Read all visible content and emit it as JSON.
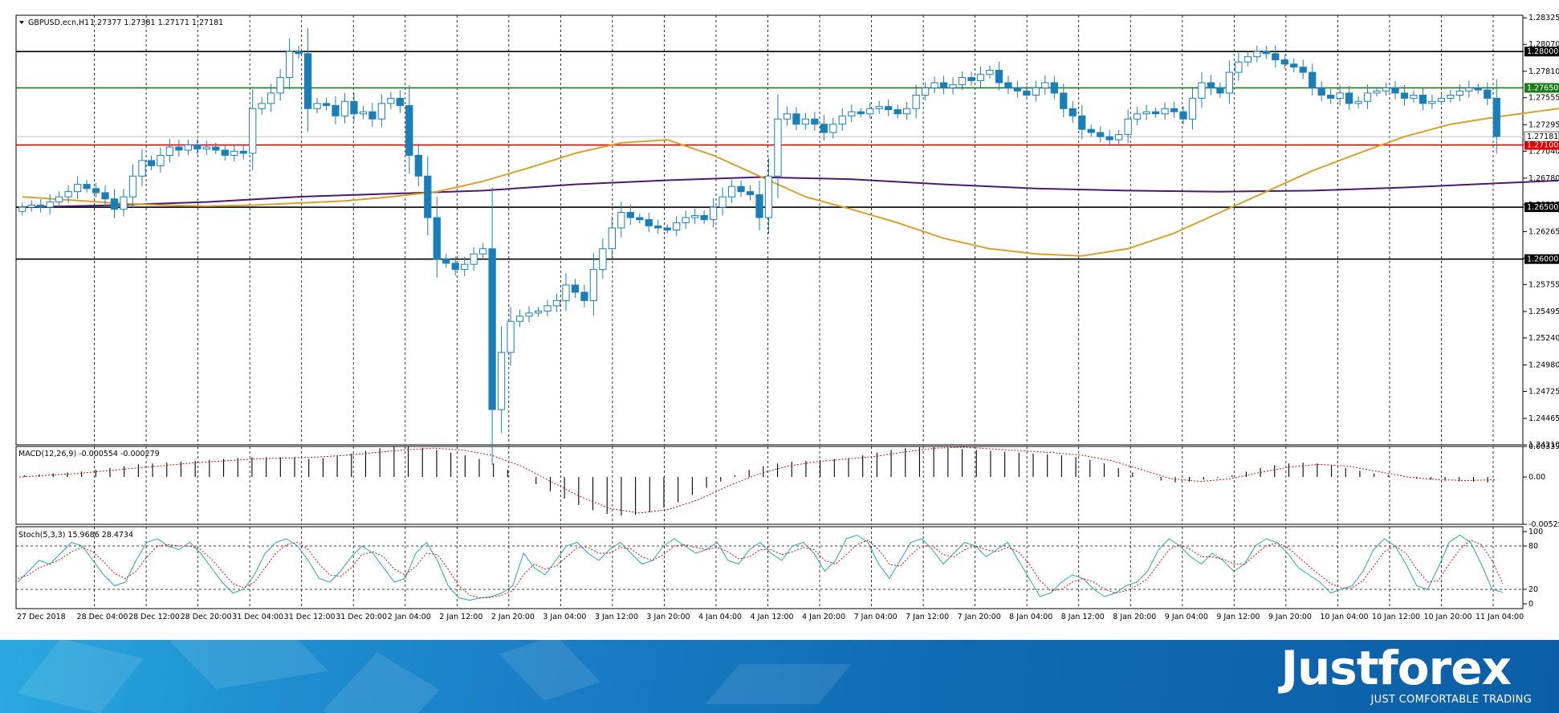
{
  "chart_data": {
    "type": "candlestick",
    "symbol_label": "GBPUSD.ecn,H1",
    "ohlc_label": "1.27377 1.27381 1.27171 1.27181",
    "price_axis": {
      "ylim": [
        1.2421,
        1.2835
      ],
      "ticks": [
        "1.28325",
        "1.28070",
        "1.27810",
        "1.27555",
        "1.27295",
        "1.27040",
        "1.26780",
        "1.26525",
        "1.26265",
        "1.26010",
        "1.25755",
        "1.25495",
        "1.25240",
        "1.24980",
        "1.24725",
        "1.24465",
        "1.24210"
      ]
    },
    "x_axis_labels": [
      "27 Dec 2018",
      "28 Dec 04:00",
      "28 Dec 12:00",
      "28 Dec 20:00",
      "31 Dec 04:00",
      "31 Dec 12:00",
      "31 Dec 20:00",
      "2 Jan 04:00",
      "2 Jan 12:00",
      "2 Jan 20:00",
      "3 Jan 04:00",
      "3 Jan 12:00",
      "3 Jan 20:00",
      "4 Jan 04:00",
      "4 Jan 12:00",
      "4 Jan 20:00",
      "7 Jan 04:00",
      "7 Jan 12:00",
      "7 Jan 20:00",
      "8 Jan 04:00",
      "8 Jan 12:00",
      "8 Jan 20:00",
      "9 Jan 04:00",
      "9 Jan 12:00",
      "9 Jan 20:00",
      "10 Jan 04:00",
      "10 Jan 12:00",
      "10 Jan 20:00",
      "11 Jan 04:00"
    ],
    "horizontal_levels": [
      {
        "price": 1.28,
        "label": "1.28000",
        "color": "#000000"
      },
      {
        "price": 1.2765,
        "label": "1.27650",
        "color": "#1a7a1a"
      },
      {
        "price": 1.271,
        "label": "1.27100",
        "color": "#e00000"
      },
      {
        "price": 1.265,
        "label": "1.26500",
        "color": "#000000"
      },
      {
        "price": 1.26,
        "label": "1.26000",
        "color": "#000000"
      }
    ],
    "current_price": {
      "price": 1.27181,
      "label": "1.27181"
    },
    "colors": {
      "candle": "#1a7fb8",
      "ma_fast": "#d6a12c",
      "ma_slow": "#4b1a6b",
      "macd_signal": "#d01010",
      "stoch_main": "#2aa6a6",
      "stoch_signal": "#d01010"
    },
    "close": [
      1.265,
      1.2652,
      1.265,
      1.2655,
      1.266,
      1.2665,
      1.2672,
      1.2668,
      1.2664,
      1.2658,
      1.2648,
      1.266,
      1.268,
      1.2695,
      1.269,
      1.27,
      1.2708,
      1.2705,
      1.271,
      1.2706,
      1.2708,
      1.2705,
      1.27,
      1.2704,
      1.2702,
      1.2745,
      1.275,
      1.276,
      1.2775,
      1.28,
      1.2798,
      1.2745,
      1.275,
      1.2748,
      1.2738,
      1.2752,
      1.274,
      1.2742,
      1.2735,
      1.275,
      1.2755,
      1.2748,
      1.27,
      1.268,
      1.264,
      1.26,
      1.2596,
      1.259,
      1.2595,
      1.2605,
      1.261,
      1.2455,
      1.251,
      1.254,
      1.2545,
      1.2548,
      1.255,
      1.2555,
      1.256,
      1.2575,
      1.2568,
      1.256,
      1.259,
      1.261,
      1.263,
      1.2645,
      1.264,
      1.2638,
      1.2632,
      1.263,
      1.2628,
      1.2635,
      1.264,
      1.2642,
      1.2638,
      1.265,
      1.266,
      1.267,
      1.2665,
      1.2662,
      1.264,
      1.268,
      1.2735,
      1.274,
      1.273,
      1.2735,
      1.273,
      1.2722,
      1.273,
      1.2738,
      1.2742,
      1.274,
      1.2745,
      1.2747,
      1.2744,
      1.274,
      1.2745,
      1.2758,
      1.2765,
      1.277,
      1.2765,
      1.2768,
      1.2775,
      1.2772,
      1.2778,
      1.2782,
      1.277,
      1.2765,
      1.2762,
      1.2758,
      1.2765,
      1.277,
      1.276,
      1.2745,
      1.2738,
      1.2725,
      1.2722,
      1.2718,
      1.2715,
      1.272,
      1.2735,
      1.274,
      1.2742,
      1.274,
      1.2745,
      1.2742,
      1.2735,
      1.2755,
      1.277,
      1.2765,
      1.276,
      1.278,
      1.279,
      1.2795,
      1.28,
      1.2798,
      1.2792,
      1.2788,
      1.2785,
      1.278,
      1.2765,
      1.2758,
      1.2755,
      1.276,
      1.275,
      1.2752,
      1.276,
      1.2762,
      1.2765,
      1.276,
      1.2755,
      1.2758,
      1.275,
      1.2752,
      1.2755,
      1.2758,
      1.2762,
      1.2765,
      1.2763,
      1.2755,
      1.27181
    ],
    "ma_fast": [
      1.266,
      1.2657,
      1.2654,
      1.2652,
      1.2651,
      1.2652,
      1.2654,
      1.2656,
      1.266,
      1.2665,
      1.2675,
      1.2688,
      1.2702,
      1.2712,
      1.2715,
      1.27,
      1.268,
      1.266,
      1.2648,
      1.2635,
      1.262,
      1.261,
      1.2605,
      1.2603,
      1.261,
      1.2625,
      1.2645,
      1.2665,
      1.2685,
      1.2702,
      1.2718,
      1.273,
      1.2737,
      1.2743,
      1.2749,
      1.2751,
      1.275,
      1.2752,
      1.2753,
      1.2753,
      1.2752,
      1.2754,
      1.2755,
      1.2756,
      1.2757,
      1.2757
    ],
    "ma_fast_x": [
      0,
      5,
      10,
      15,
      20,
      25,
      30,
      35,
      40,
      45,
      50,
      55,
      60,
      65,
      70,
      75,
      80,
      85,
      90,
      95,
      100,
      105,
      110,
      115,
      120,
      125,
      130,
      135,
      140,
      145,
      150,
      155,
      160,
      165,
      170,
      175,
      180,
      185,
      190,
      195,
      200,
      205,
      210,
      215,
      220,
      223
    ],
    "ma_slow": [
      1.265,
      1.2652,
      1.2655,
      1.266,
      1.2663,
      1.2666,
      1.2672,
      1.2676,
      1.2679,
      1.2677,
      1.2672,
      1.2668,
      1.2666,
      1.2665,
      1.2666,
      1.2669,
      1.2673,
      1.2677,
      1.2681,
      1.2684,
      1.2688,
      1.2692,
      1.2697,
      1.2702,
      1.2706,
      1.2709,
      1.271
    ],
    "ma_slow_x": [
      0,
      10,
      20,
      30,
      40,
      50,
      60,
      70,
      80,
      90,
      100,
      110,
      120,
      130,
      140,
      150,
      160,
      170,
      180,
      190,
      200,
      210,
      220,
      230,
      240,
      250,
      255
    ],
    "macd": {
      "label": "MACD(12,26,9) -0.000554 -0.000279",
      "ylim": [
        -0.005256,
        0.003393
      ],
      "ticks": [
        "0.003393",
        "0.00",
        "-0.005256"
      ],
      "hist": [
        0.0002,
        0.0003,
        0.0004,
        0.0005,
        0.0006,
        0.0008,
        0.001,
        0.0012,
        0.0014,
        0.0015,
        0.0016,
        0.0017,
        0.0018,
        0.0019,
        0.002,
        0.0021,
        0.0022,
        0.0022,
        0.0022,
        0.0022,
        0.002,
        0.0021,
        0.0023,
        0.0026,
        0.0029,
        0.0032,
        0.0034,
        0.0034,
        0.0032,
        0.003,
        0.0027,
        0.0024,
        0.002,
        0.0015,
        0.0008,
        0.0,
        -0.0008,
        -0.0016,
        -0.0024,
        -0.0031,
        -0.0037,
        -0.0041,
        -0.0043,
        -0.0042,
        -0.0039,
        -0.0034,
        -0.0028,
        -0.002,
        -0.0012,
        -0.0005,
        0.0002,
        0.0008,
        0.0012,
        0.0015,
        0.0017,
        0.0018,
        0.0019,
        0.002,
        0.0021,
        0.0024,
        0.0027,
        0.003,
        0.0032,
        0.0033,
        0.0033,
        0.0032,
        0.0031,
        0.003,
        0.0029,
        0.0028,
        0.0027,
        0.0026,
        0.0025,
        0.0024,
        0.0022,
        0.0019,
        0.0015,
        0.001,
        0.0005,
        0.0,
        -0.0004,
        -0.0006,
        -0.0005,
        -0.0003,
        -0.0001,
        0.0002,
        0.0006,
        0.001,
        0.0013,
        0.0015,
        0.0016,
        0.0015,
        0.0013,
        0.001,
        0.0007,
        0.0004,
        0.0002,
        0.0,
        -0.0002,
        -0.0003,
        -0.0004,
        -0.0005,
        -0.0005,
        -0.0006
      ],
      "signal": [
        0.0,
        0.0002,
        0.0004,
        0.0007,
        0.001,
        0.0013,
        0.0016,
        0.0018,
        0.002,
        0.0021,
        0.0022,
        0.0024,
        0.0027,
        0.003,
        0.0032,
        0.003,
        0.0024,
        0.0012,
        -0.0005,
        -0.0022,
        -0.0035,
        -0.004,
        -0.0036,
        -0.0025,
        -0.001,
        0.0003,
        0.0012,
        0.0017,
        0.002,
        0.0023,
        0.0028,
        0.0032,
        0.0033,
        0.0031,
        0.0029,
        0.0027,
        0.0024,
        0.0018,
        0.0008,
        -0.0002,
        -0.0005,
        -0.0002,
        0.0005,
        0.0011,
        0.0014,
        0.0012,
        0.0006,
        0.0,
        -0.0003,
        -0.0004,
        -0.0003
      ]
    },
    "stoch": {
      "label": "Stoch(5,3,3) 15.9686 28.4734",
      "ylim": [
        0,
        100
      ],
      "ticks": [
        "100",
        "80",
        "20",
        "0"
      ],
      "levels": [
        80,
        20
      ],
      "main": [
        30,
        45,
        60,
        55,
        70,
        85,
        80,
        60,
        40,
        25,
        30,
        60,
        85,
        90,
        80,
        75,
        85,
        70,
        50,
        30,
        15,
        20,
        40,
        70,
        85,
        90,
        80,
        60,
        35,
        30,
        45,
        65,
        80,
        70,
        50,
        30,
        35,
        70,
        85,
        60,
        25,
        8,
        5,
        8,
        10,
        15,
        25,
        70,
        50,
        40,
        60,
        80,
        85,
        70,
        60,
        75,
        85,
        70,
        55,
        60,
        80,
        90,
        80,
        70,
        75,
        85,
        60,
        55,
        75,
        85,
        70,
        60,
        80,
        85,
        70,
        45,
        60,
        90,
        95,
        85,
        55,
        35,
        60,
        85,
        90,
        75,
        55,
        70,
        85,
        80,
        65,
        75,
        85,
        60,
        35,
        10,
        15,
        30,
        40,
        35,
        20,
        10,
        15,
        25,
        30,
        45,
        75,
        90,
        80,
        65,
        55,
        70,
        60,
        45,
        55,
        80,
        90,
        85,
        70,
        50,
        40,
        30,
        15,
        20,
        25,
        45,
        75,
        90,
        80,
        55,
        25,
        20,
        50,
        85,
        95,
        85,
        55,
        20,
        16
      ],
      "signal": [
        35,
        40,
        50,
        55,
        62,
        72,
        78,
        72,
        58,
        42,
        35,
        45,
        65,
        80,
        82,
        80,
        80,
        75,
        62,
        45,
        28,
        22,
        30,
        50,
        70,
        82,
        85,
        75,
        55,
        40,
        38,
        50,
        68,
        72,
        65,
        48,
        40,
        52,
        70,
        68,
        48,
        25,
        12,
        8,
        9,
        12,
        18,
        40,
        55,
        48,
        52,
        65,
        78,
        78,
        70,
        70,
        78,
        76,
        65,
        60,
        68,
        80,
        82,
        78,
        75,
        78,
        72,
        62,
        65,
        75,
        75,
        68,
        72,
        78,
        75,
        60,
        55,
        68,
        82,
        88,
        75,
        55,
        52,
        68,
        80,
        80,
        68,
        65,
        75,
        80,
        75,
        72,
        78,
        72,
        55,
        32,
        18,
        20,
        30,
        35,
        30,
        20,
        15,
        18,
        25,
        35,
        55,
        75,
        82,
        75,
        65,
        65,
        62,
        55,
        55,
        68,
        80,
        84,
        78,
        65,
        52,
        40,
        28,
        22,
        22,
        32,
        52,
        72,
        80,
        70,
        48,
        30,
        32,
        55,
        75,
        88,
        82,
        60,
        28
      ]
    },
    "branding": {
      "logo": "Justforex",
      "slogan": "JUST COMFORTABLE TRADING"
    }
  }
}
